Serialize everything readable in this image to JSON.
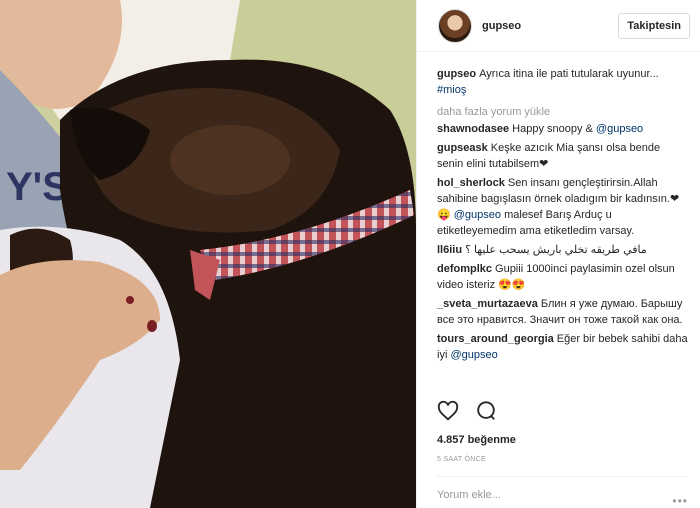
{
  "header": {
    "username": "gupseo",
    "follow_label": "Takiptesin"
  },
  "caption": {
    "user": "gupseo",
    "text": "Ayrıca itina ile pati tutularak uyunur...",
    "hashtag": "#mioş"
  },
  "load_more_label": "daha fazla yorum yükle",
  "comments": [
    {
      "user": "shawnodasee",
      "text": "Happy snoopy &",
      "mention": "@gupseo",
      "tail": ""
    },
    {
      "user": "gupseask",
      "text": "Keşke azıcık Mia şansı olsa bende senin elini tutabilsem❤",
      "mention": "",
      "tail": ""
    },
    {
      "user": "hol_sherlock",
      "text": "Sen insanı gençleştirirsin.Allah sahibine bagışlasın örnek oladıgım bir kadınsın.❤😛",
      "mention": "@gupseo",
      "tail": "malesef Barış Arduç u etiketleyemedim ama etiketledim varsay."
    },
    {
      "user": "ll6iiu",
      "text": "مافي طريقه تخلي باريش يسحب عليها ؟",
      "mention": "",
      "tail": ""
    },
    {
      "user": "defomplkc",
      "text": "Gupiii 1000inci paylasimin ozel olsun video isteriz 😍😍",
      "mention": "",
      "tail": ""
    },
    {
      "user": "_sveta_murtazaeva",
      "text": "Блин я уже думаю. Барышу все это нравится. Значит он тоже такой как она.",
      "mention": "",
      "tail": ""
    },
    {
      "user": "tours_around_georgia",
      "text": "Eğer bir bebek sahibi daha iyi",
      "mention": "@gupseo",
      "tail": ""
    }
  ],
  "icons": {
    "like": "heart-icon",
    "comment": "comment-bubble-icon"
  },
  "likes_text": "4.857 beğenme",
  "time_text": "5 SAAT ÖNCE",
  "add_comment_placeholder": "Yorum ekle...",
  "more_label": "•••"
}
